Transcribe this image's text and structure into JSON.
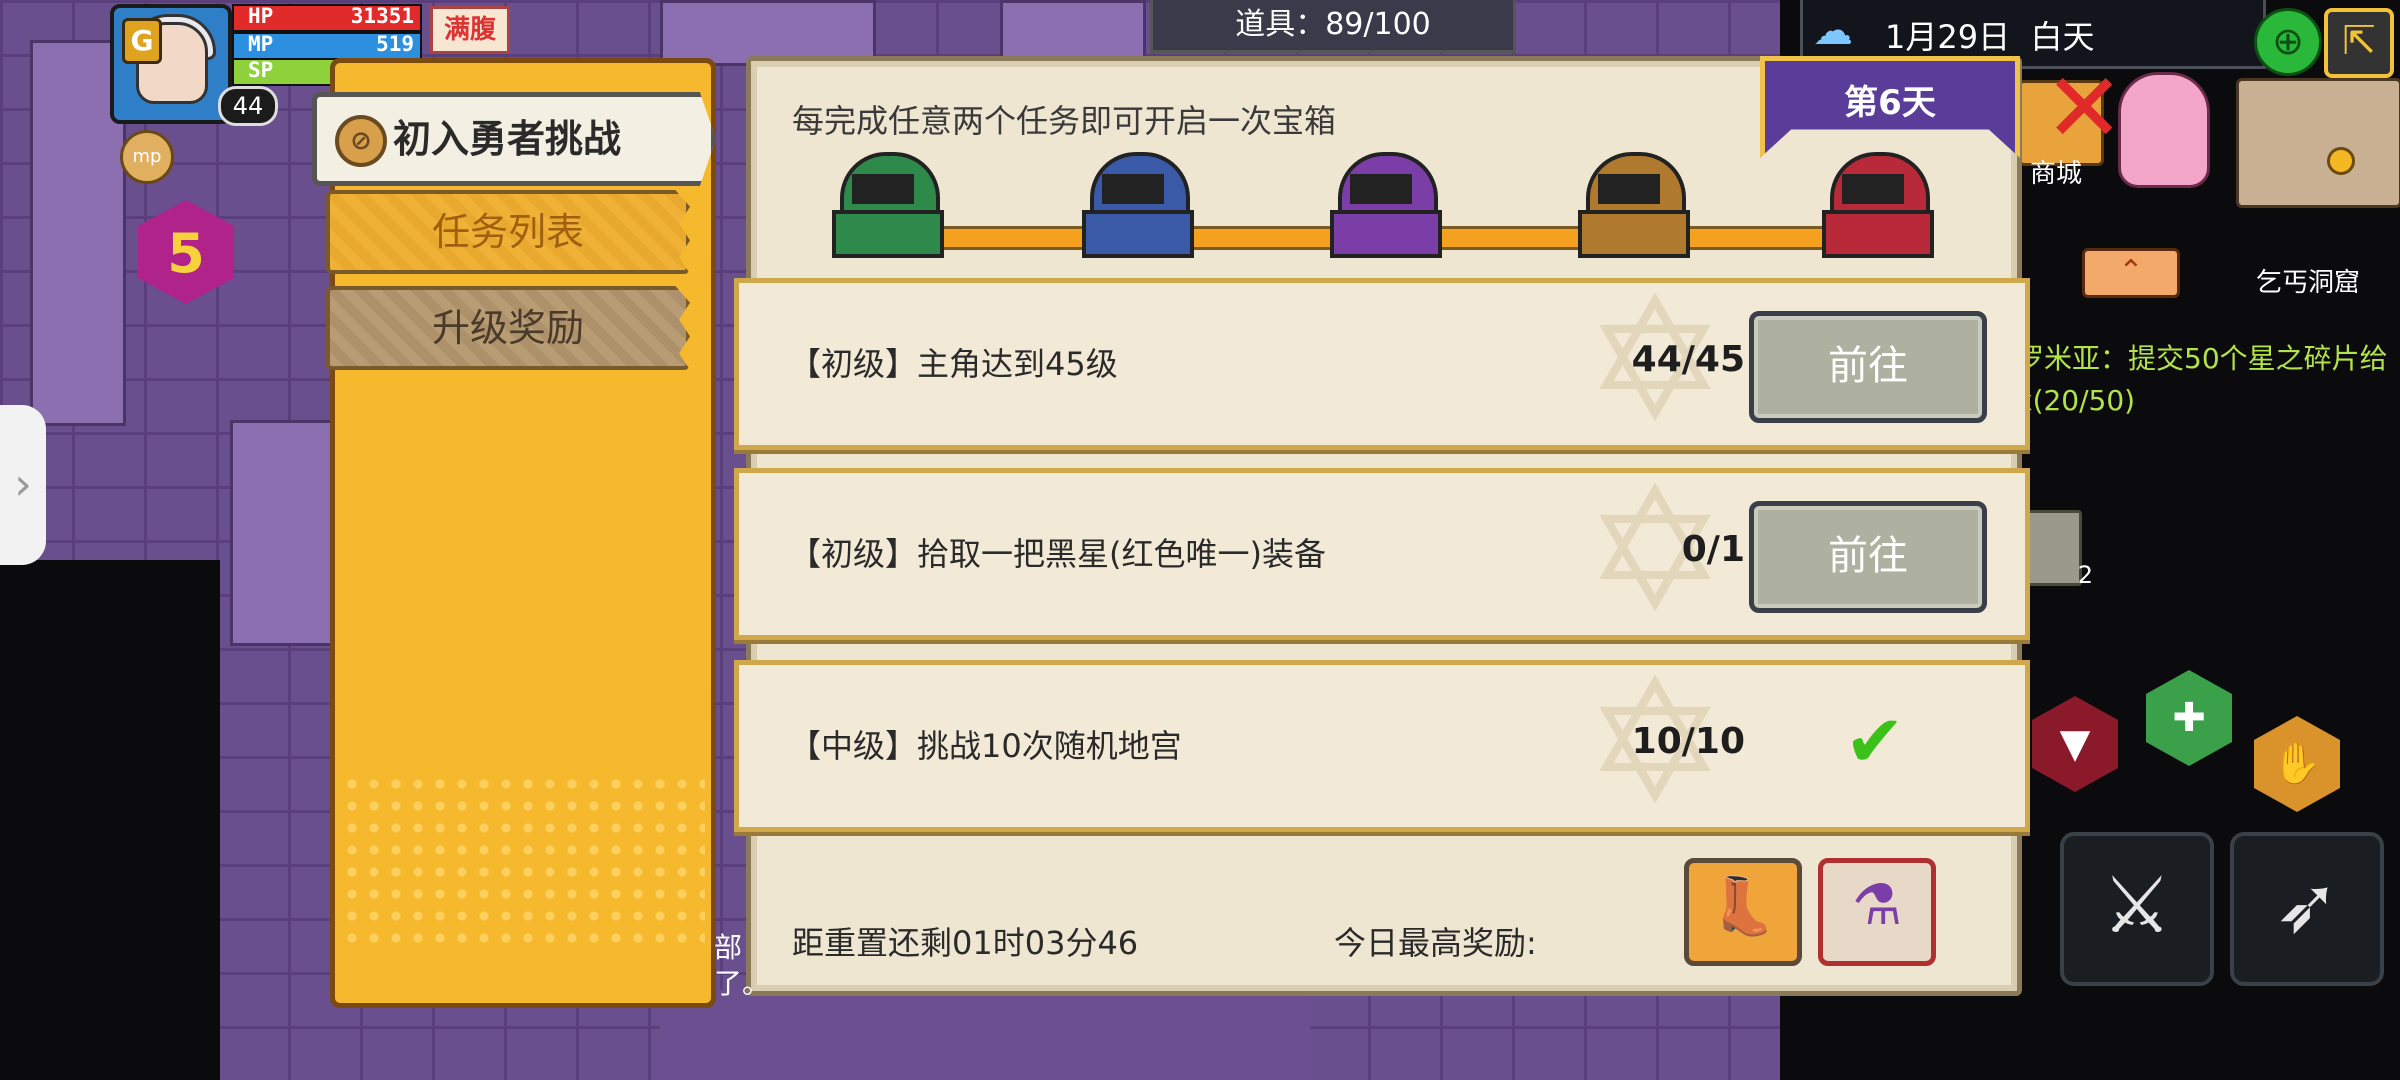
{
  "hud": {
    "hp_label": "HP",
    "hp_value": "31351",
    "mp_label": "MP",
    "mp_value": "519",
    "sp_label": "SP",
    "player_level": "44",
    "status_badge": "满腹",
    "coin_label": "mp",
    "floor_level": "5"
  },
  "topbar": {
    "items_count": "道具：89/100",
    "date": "1月29日",
    "time_of_day": "白天"
  },
  "right_hud": {
    "shop_label": "商城",
    "location": "乞丐洞窟",
    "quest_line1": "罗米亚：提交50个星之碎片给",
    "quest_line2": "x(20/50)",
    "small_item_count": "2"
  },
  "left_panel": {
    "challenge_title": "初入勇者挑战",
    "tabs": [
      "任务列表",
      "升级奖励"
    ],
    "active_tab": 0
  },
  "main_panel": {
    "day_banner": "第6天",
    "instruction": "每完成任意两个任务即可开启一次宝箱",
    "chests": [
      {
        "color": "#2e8a4a"
      },
      {
        "color": "#3a5aa8"
      },
      {
        "color": "#7a3ea6"
      },
      {
        "color": "#b07a2e"
      },
      {
        "color": "#b82a3a"
      }
    ],
    "tasks": [
      {
        "label": "【初级】主角达到45级",
        "progress": "44/45",
        "action": "前往",
        "completed": false
      },
      {
        "label": "【初级】拾取一把黑星(红色唯一)装备",
        "progress": "0/1",
        "action": "前往",
        "completed": false
      },
      {
        "label": "【中级】挑战10次随机地宫",
        "progress": "10/10",
        "action": "",
        "completed": true
      }
    ],
    "countdown": "距重置还剩01时03分46",
    "reward_label": "今日最高奖励:"
  },
  "chat_tip": [
    "部",
    "了。"
  ],
  "colors": {
    "panel_orange": "#f6b82c",
    "dialog_bg": "#efe6d2",
    "banner_purple": "#5a3d98",
    "go_button": "#aeb0a0",
    "check_green": "#3cc11a"
  }
}
